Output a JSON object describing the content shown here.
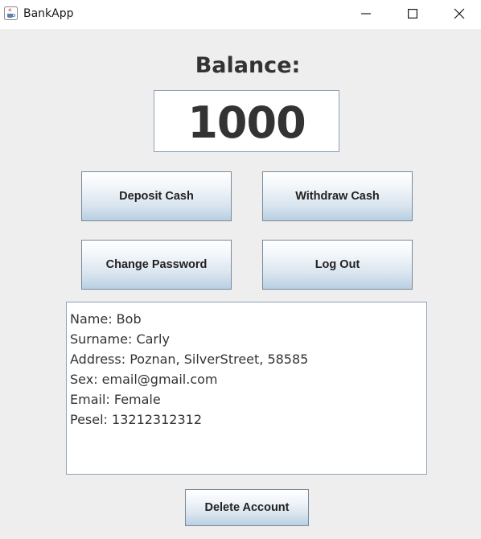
{
  "window": {
    "title": "BankApp",
    "icon": "java-cup-icon",
    "controls": {
      "minimize_icon": "minimize-icon",
      "maximize_icon": "maximize-icon",
      "close_icon": "close-icon"
    }
  },
  "balance": {
    "label": "Balance:",
    "value": "1000"
  },
  "buttons": {
    "deposit": "Deposit Cash",
    "withdraw": "Withdraw Cash",
    "change_password": "Change Password",
    "log_out": "Log Out",
    "delete_account": "Delete Account"
  },
  "info": {
    "lines": [
      "Name: Bob",
      "Surname: Carly",
      "Address: Poznan, SilverStreet, 58585",
      "Sex: email@gmail.com",
      "Email: Female",
      "Pesel: 13212312312"
    ]
  }
}
